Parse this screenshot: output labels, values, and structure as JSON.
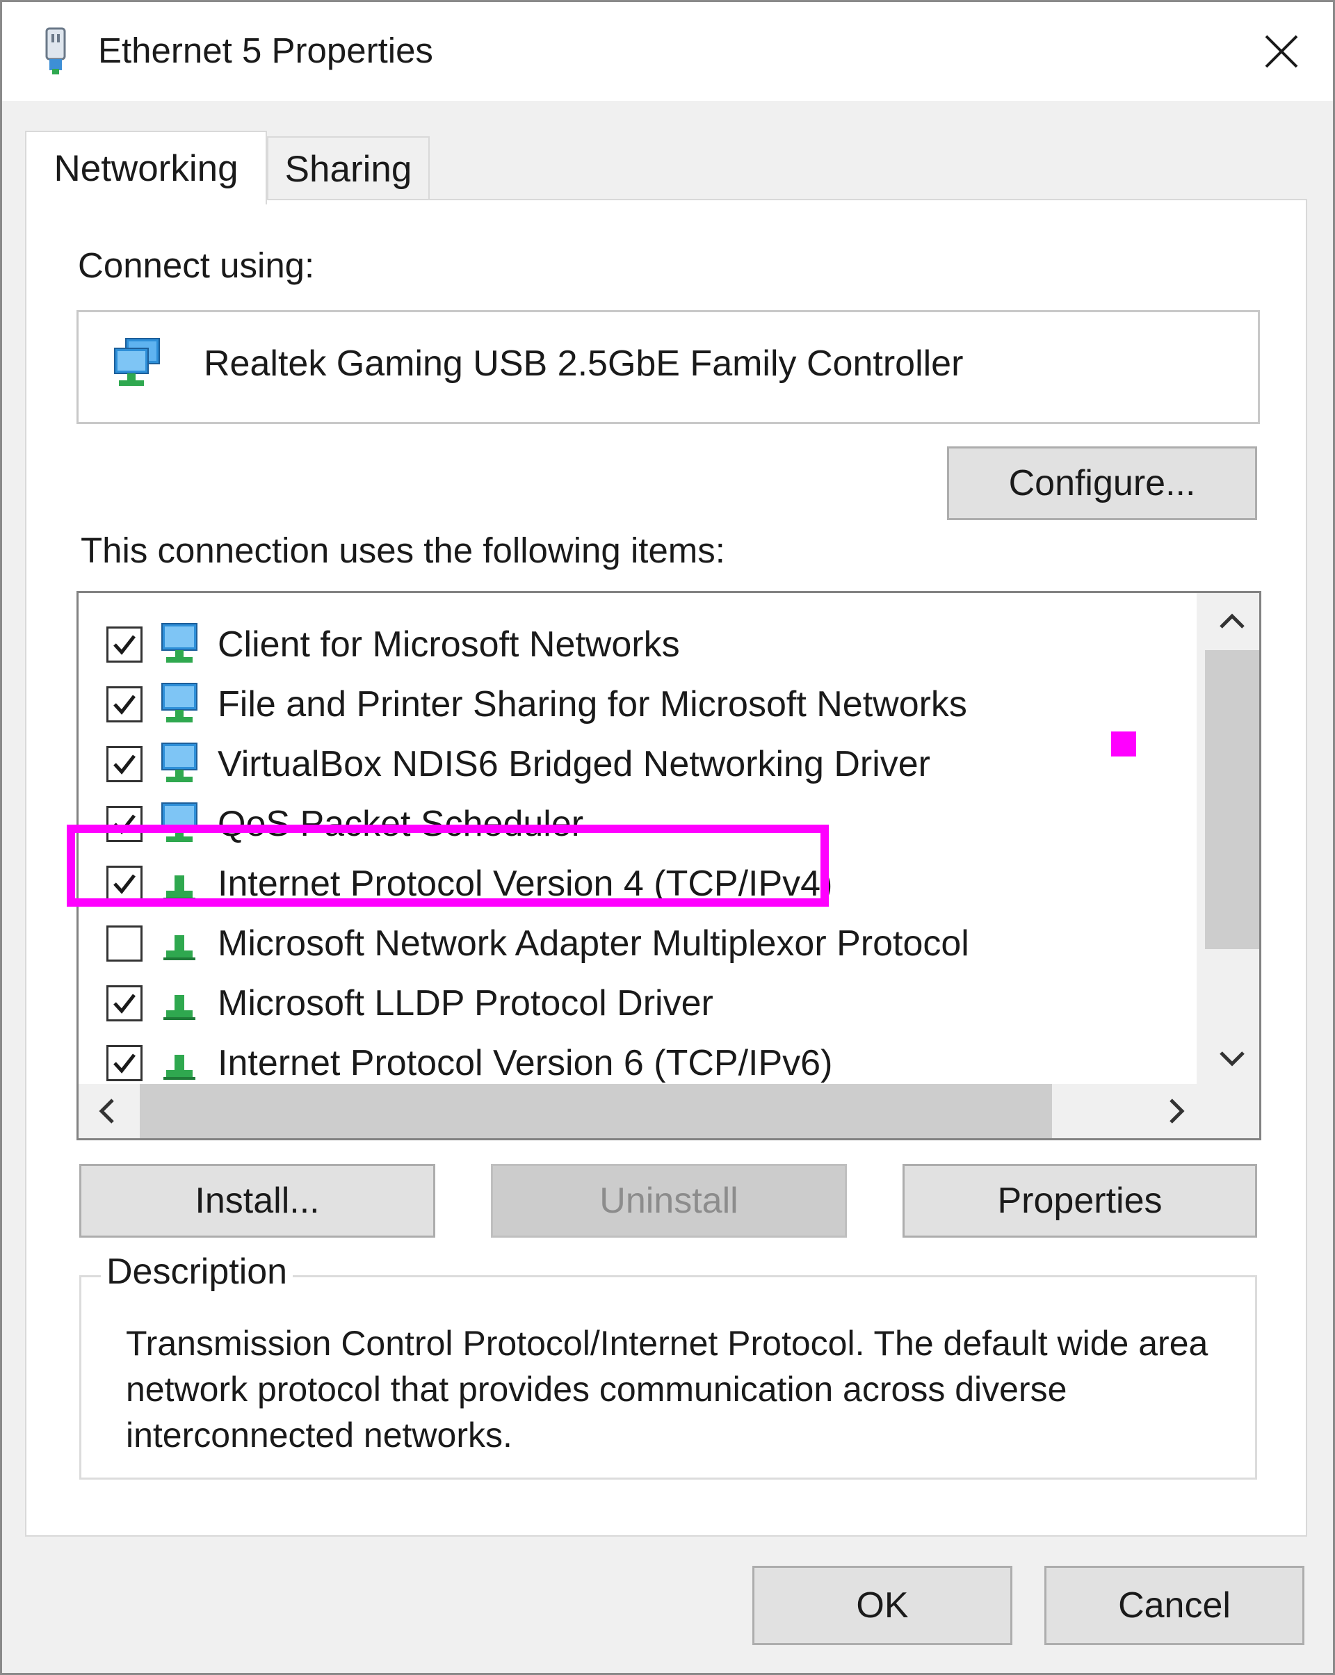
{
  "window": {
    "title": "Ethernet 5 Properties",
    "icon": "network-adapter-icon",
    "close_icon": "close-icon"
  },
  "tabs": [
    {
      "label": "Networking",
      "active": true
    },
    {
      "label": "Sharing",
      "active": false
    }
  ],
  "connect_using": {
    "label": "Connect using:",
    "adapter_name": "Realtek Gaming USB 2.5GbE Family Controller",
    "adapter_icon": "network-adapter-icon"
  },
  "buttons": {
    "configure": "Configure...",
    "install": "Install...",
    "uninstall": "Uninstall",
    "properties": "Properties",
    "ok": "OK",
    "cancel": "Cancel"
  },
  "items_label": "This connection uses the following items:",
  "items": [
    {
      "label": "Client for Microsoft Networks",
      "checked": true,
      "icon": "client-icon"
    },
    {
      "label": "File and Printer Sharing for Microsoft Networks",
      "checked": true,
      "icon": "service-icon"
    },
    {
      "label": "VirtualBox NDIS6 Bridged Networking Driver",
      "checked": true,
      "icon": "service-icon"
    },
    {
      "label": "QoS Packet Scheduler",
      "checked": true,
      "icon": "service-icon"
    },
    {
      "label": "Internet Protocol Version 4 (TCP/IPv4)",
      "checked": true,
      "icon": "protocol-icon",
      "highlighted": true
    },
    {
      "label": "Microsoft Network Adapter Multiplexor Protocol",
      "checked": false,
      "icon": "protocol-icon"
    },
    {
      "label": "Microsoft LLDP Protocol Driver",
      "checked": true,
      "icon": "protocol-icon"
    },
    {
      "label": "Internet Protocol Version 6 (TCP/IPv6)",
      "checked": true,
      "icon": "protocol-icon"
    }
  ],
  "description": {
    "legend": "Description",
    "text": "Transmission Control Protocol/Internet Protocol. The default wide area network protocol that provides communication across diverse interconnected networks."
  },
  "colors": {
    "highlight": "#ff00ff",
    "protocol_green": "#2fa84f",
    "monitor_blue": "#2e8fd8"
  }
}
